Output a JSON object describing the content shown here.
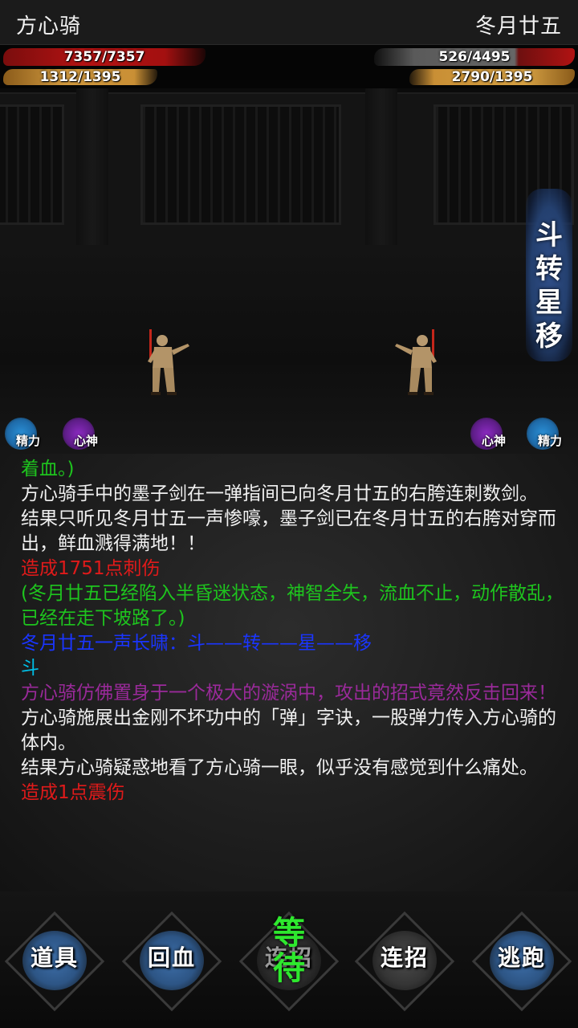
{
  "player": {
    "name": "方心骑",
    "hp": "7357/7357",
    "energy": "1312/1395",
    "stats": {
      "stamina_label": "精力",
      "mind_label": "心神"
    }
  },
  "enemy": {
    "name": "冬月廿五",
    "hp": "526/4495",
    "energy": "2790/1395",
    "stats": {
      "stamina_label": "精力",
      "mind_label": "心神"
    }
  },
  "banner": {
    "chars": [
      "斗",
      "转",
      "星",
      "移"
    ]
  },
  "log": [
    {
      "text": "着血。)",
      "style": "c-green"
    },
    {
      "text": "方心骑手中的墨子剑在一弹指间已向冬月廿五的右胯连刺数剑。",
      "style": ""
    },
    {
      "text": "结果只听见冬月廿五一声惨嚎，墨子剑已在冬月廿五的右胯对穿而出，鲜血溅得满地！！",
      "style": ""
    },
    {
      "text": "造成1751点刺伤",
      "style": "c-red"
    },
    {
      "text": "(冬月廿五已经陷入半昏迷状态，神智全失，流血不止，动作散乱，已经在走下坡路了。)",
      "style": "c-green"
    },
    {
      "text": "冬月廿五一声长啸：斗——转——星——移",
      "style": "c-blue"
    },
    {
      "text": "斗",
      "style": "c-cyan"
    },
    {
      "text": "方心骑仿佛置身于一个极大的漩涡中，攻出的招式竟然反击回来！",
      "style": "c-purple"
    },
    {
      "text": "方心骑施展出金刚不坏功中的「弹」字诀，一股弹力传入方心骑的体内。",
      "style": ""
    },
    {
      "text": "结果方心骑疑惑地看了方心骑一眼，似乎没有感觉到什么痛处。",
      "style": ""
    },
    {
      "text": "造成1点震伤",
      "style": "c-red"
    }
  ],
  "actions": [
    {
      "label": "道具",
      "color": "#3d6ea8"
    },
    {
      "label": "回血",
      "color": "#3d6ea8"
    },
    {
      "label": "连招",
      "color": "#3a3a3a"
    },
    {
      "label": "连招",
      "color": "#4a4a4a"
    },
    {
      "label": "逃跑",
      "color": "#3d6ea8"
    }
  ],
  "wait_label": "等待",
  "colors": {
    "hp_red": "#b31313",
    "energy_gold": "#d29a3f",
    "stamina_orb": "#2a8fd6",
    "mind_orb": "#7a2ab0",
    "wait_green": "#2ee82e"
  }
}
